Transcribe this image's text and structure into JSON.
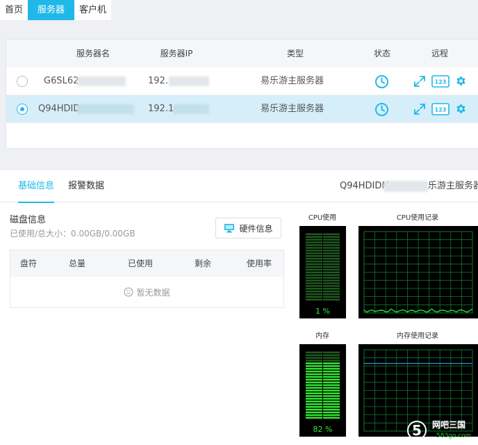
{
  "top_tabs": [
    "首页",
    "服务器",
    "客户机"
  ],
  "table": {
    "headers": {
      "name": "服务器名",
      "ip": "服务器IP",
      "type": "类型",
      "status": "状态",
      "remote": "远程"
    },
    "rows": [
      {
        "name": "G6SL62",
        "ip": "192.",
        "type": "易乐游主服务器",
        "selected": false,
        "remote_id": "123"
      },
      {
        "name": "Q94HDID",
        "ip": "192.1",
        "type": "易乐游主服务器",
        "selected": true,
        "remote_id": "123"
      }
    ]
  },
  "sub_tabs": [
    "基础信息",
    "报警数据"
  ],
  "selected_server": {
    "name": "Q94HDIDM",
    "type_suffix": "乐游主服务器"
  },
  "disk": {
    "title": "磁盘信息",
    "usage": "已使用/总大小：0.00GB/0.00GB",
    "hardware_button": "硬件信息",
    "columns": [
      "盘符",
      "总量",
      "已使用",
      "剩余",
      "使用率"
    ],
    "empty": "暂无数据"
  },
  "monitor": {
    "cpu": {
      "title": "CPU使用",
      "history_title": "CPU使用记录",
      "percent": 1,
      "label": "1 %"
    },
    "memory": {
      "title": "内存",
      "history_title": "内存使用记录",
      "percent": 82,
      "label": "82 %"
    }
  },
  "colors": {
    "accent": "#1fb8e9",
    "meter_green": "#32e832",
    "grid_green": "#0d7a2e"
  },
  "watermark": {
    "text": "网吧三国",
    "site": "583go.com"
  }
}
